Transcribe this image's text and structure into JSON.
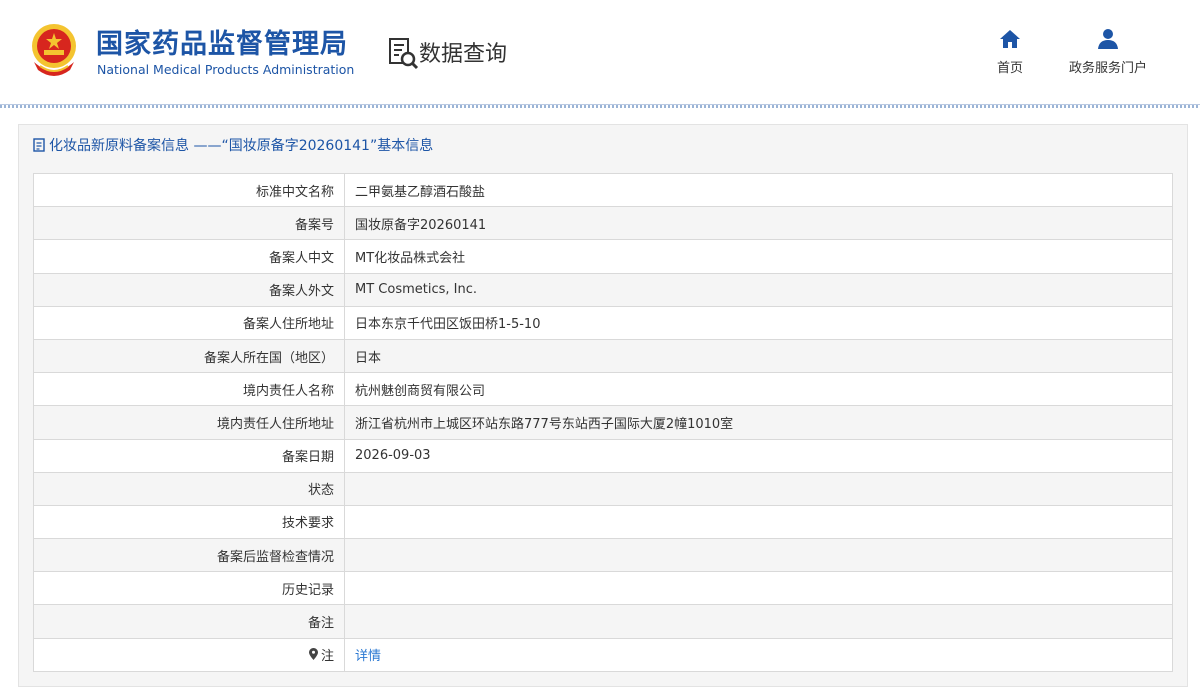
{
  "header": {
    "org_name_cn": "国家药品监督管理局",
    "org_name_en": "National Medical Products Administration",
    "section_title": "数据查询",
    "nav": [
      {
        "label": "首页",
        "icon": "home-icon"
      },
      {
        "label": "政务服务门户",
        "icon": "user-icon"
      }
    ]
  },
  "colors": {
    "brand_blue": "#1d55a6",
    "link_blue": "#2a78d2",
    "emblem_red": "#d7261e",
    "emblem_gold": "#f4c430"
  },
  "panel": {
    "title": "化妆品新原料备案信息 ——“国妆原备字20260141”基本信息",
    "rows": [
      {
        "label": "标准中文名称",
        "value": "二甲氨基乙醇酒石酸盐"
      },
      {
        "label": "备案号",
        "value": "国妆原备字20260141"
      },
      {
        "label": "备案人中文",
        "value": "MT化妆品株式会社"
      },
      {
        "label": "备案人外文",
        "value": "MT Cosmetics, Inc."
      },
      {
        "label": "备案人住所地址",
        "value": "日本东京千代田区饭田桥1-5-10"
      },
      {
        "label": "备案人所在国（地区）",
        "value": "日本"
      },
      {
        "label": "境内责任人名称",
        "value": "杭州魅创商贸有限公司"
      },
      {
        "label": "境内责任人住所地址",
        "value": "浙江省杭州市上城区环站东路777号东站西子国际大厦2幢1010室"
      },
      {
        "label": "备案日期",
        "value": "2026-09-03"
      },
      {
        "label": "状态",
        "value": ""
      },
      {
        "label": "技术要求",
        "value": ""
      },
      {
        "label": "备案后监督检查情况",
        "value": ""
      },
      {
        "label": "历史记录",
        "value": ""
      },
      {
        "label": "备注",
        "value": ""
      }
    ],
    "note": {
      "label": "注",
      "link_text": "详情",
      "icon": "pin-icon"
    }
  }
}
